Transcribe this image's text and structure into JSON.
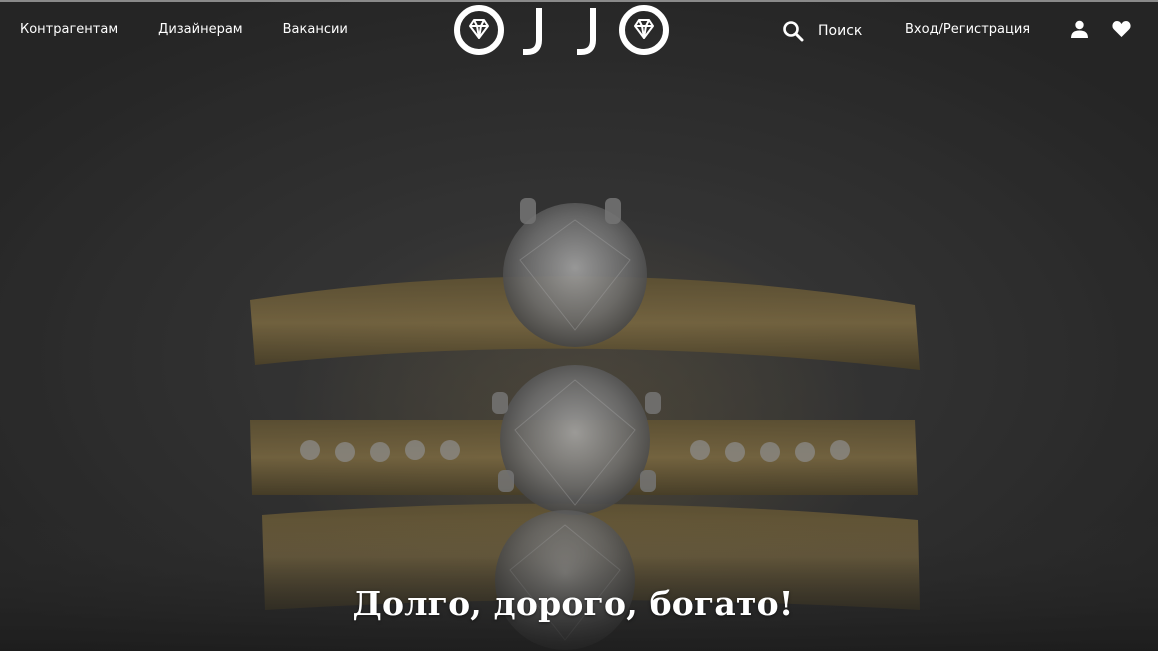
{
  "header": {
    "nav_left": [
      {
        "label": "Контрагентам"
      },
      {
        "label": "Дизайнерам"
      },
      {
        "label": "Вакансии"
      }
    ],
    "logo_text": "OJJO",
    "search_label": "Поиск",
    "login_label": "Вход/Регистрация",
    "icons": [
      "search-icon",
      "user-icon",
      "heart-icon",
      "diamond-icon"
    ]
  },
  "hero": {
    "headline": "Долго, дорого, богато!"
  },
  "colors": {
    "text": "#ffffff",
    "background": "#2f2f2f",
    "gold": "#8a7440"
  }
}
